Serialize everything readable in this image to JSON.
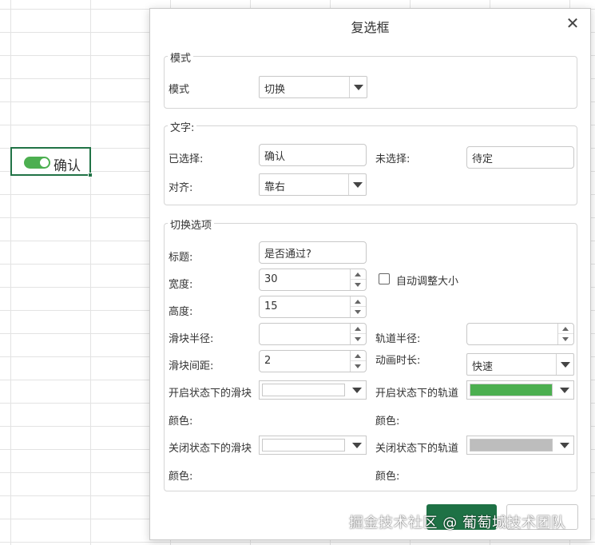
{
  "sheet": {
    "cell_text": "确认"
  },
  "dialog": {
    "title": "复选框",
    "close_glyph": "✕",
    "mode_group": {
      "legend": "模式",
      "mode_label": "模式",
      "mode_value": "切换"
    },
    "text_group": {
      "legend": "文字:",
      "checked_label": "已选择:",
      "checked_value": "确认",
      "unchecked_label": "未选择:",
      "unchecked_value": "待定",
      "align_label": "对齐:",
      "align_value": "靠右"
    },
    "toggle_group": {
      "legend": "切换选项",
      "title_label": "标题:",
      "title_value": "是否通过?",
      "width_label": "宽度:",
      "width_value": "30",
      "autosize_label": "自动调整大小",
      "autosize_checked": false,
      "height_label": "高度:",
      "height_value": "15",
      "slider_radius_label": "滑块半径:",
      "slider_radius_value": "",
      "track_radius_label": "轨道半径:",
      "track_radius_value": "",
      "slider_gap_label": "滑块间距:",
      "slider_gap_value": "2",
      "animation_label": "动画时长:",
      "animation_value": "快速",
      "on_slider_label_1": "开启状态下的滑块",
      "on_slider_label_2": "颜色:",
      "on_slider_color": "#ffffff",
      "on_track_label_1": "开启状态下的轨道",
      "on_track_label_2": "颜色:",
      "on_track_color": "#4caf50",
      "off_slider_label_1": "关闭状态下的滑块",
      "off_slider_label_2": "颜色:",
      "off_slider_color": "#ffffff",
      "off_track_label_1": "关闭状态下的轨道",
      "off_track_label_2": "颜色:",
      "off_track_color": "#bdbdbd"
    },
    "footer": {
      "ok_label": "",
      "cancel_label": ""
    }
  },
  "watermark": "掘金技术社区 @ 葡萄城技术团队",
  "colors": {
    "accent": "#217346",
    "ok_button": "#1e7145",
    "toggle_on": "#4caf50"
  }
}
